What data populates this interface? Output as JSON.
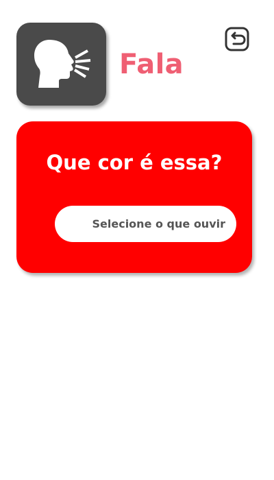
{
  "header": {
    "app_icon_name": "speaking-head-icon",
    "title": "Fala",
    "back_icon_name": "return-icon"
  },
  "card": {
    "question": "Que cor é essa?",
    "select_label": "Selecione o que ouvir",
    "background_color": "#ff0000"
  },
  "colors": {
    "title": "#ef5f73",
    "icon_tile": "#4a4a4a"
  }
}
